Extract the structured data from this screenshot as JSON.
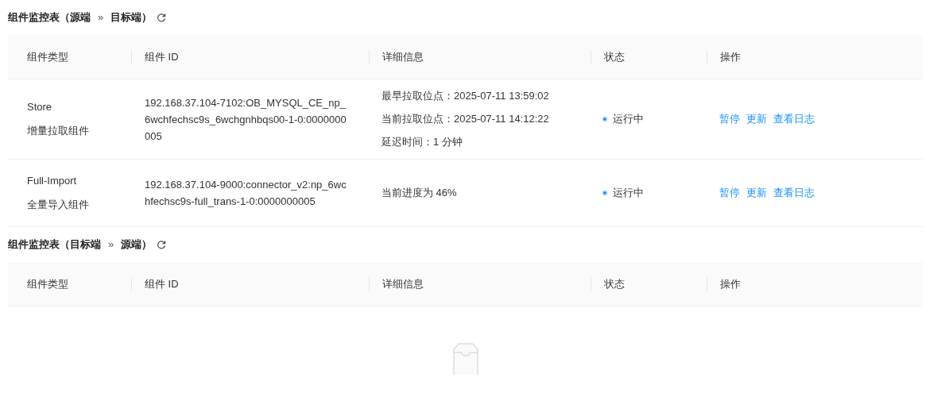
{
  "sections": [
    {
      "title": {
        "prefix": "组件监控表（源端",
        "separator": "»",
        "suffix": "目标端）"
      },
      "columns": [
        "组件类型",
        "组件 ID",
        "详细信息",
        "状态",
        "操作"
      ],
      "rows": [
        {
          "type_name": "Store",
          "type_label": "增量拉取组件",
          "id": "192.168.37.104-7102:OB_MYSQL_CE_np_6wchfechsc9s_6wchgnhbqs00-1-0:0000000005",
          "details": [
            "最早拉取位点：2025-07-11 13:59:02",
            "当前拉取位点：2025-07-11 14:12:22",
            "延迟时间：1 分钟"
          ],
          "status": {
            "kind": "running",
            "label": "运行中"
          },
          "actions": [
            "暂停",
            "更新",
            "查看日志"
          ]
        },
        {
          "type_name": "Full-Import",
          "type_label": "全量导入组件",
          "id": "192.168.37.104-9000:connector_v2:np_6wchfechsc9s-full_trans-1-0:0000000005",
          "details": [
            "当前进度为 46%"
          ],
          "status": {
            "kind": "running",
            "label": "运行中"
          },
          "actions": [
            "暂停",
            "更新",
            "查看日志"
          ]
        }
      ]
    },
    {
      "title": {
        "prefix": "组件监控表（目标端",
        "separator": "»",
        "suffix": "源端）"
      },
      "columns": [
        "组件类型",
        "组件 ID",
        "详细信息",
        "状态",
        "操作"
      ]
    }
  ]
}
